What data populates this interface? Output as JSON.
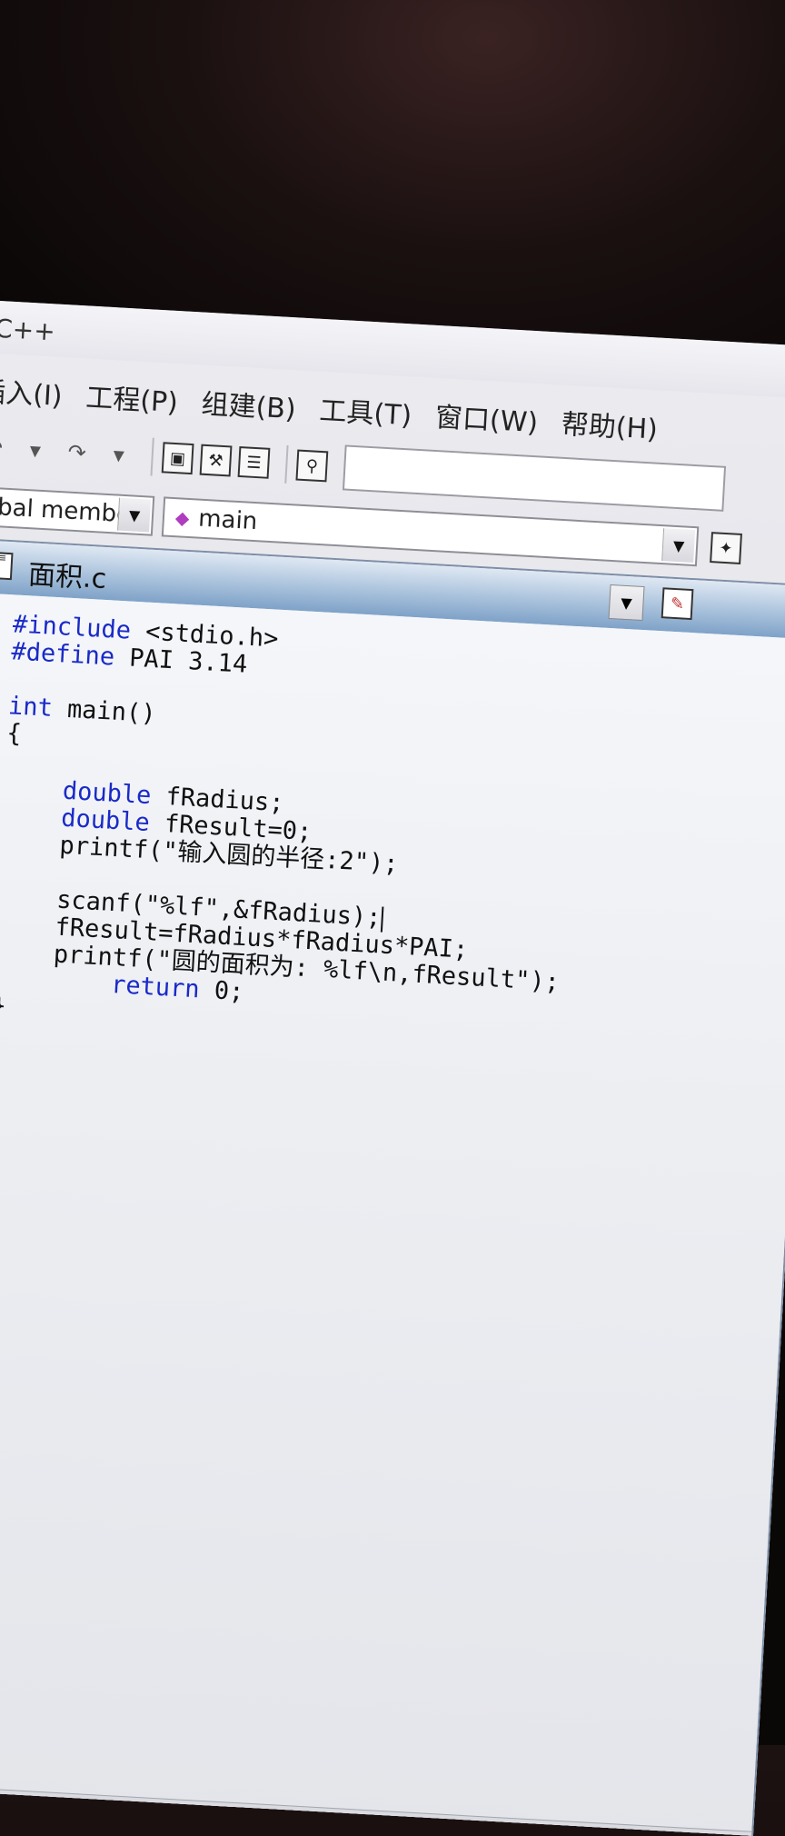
{
  "app_title": "C++",
  "menu": [
    "插入(I)",
    "工程(P)",
    "组建(B)",
    "工具(T)",
    "窗口(W)",
    "帮助(H)"
  ],
  "toolbar": {
    "undo": "↶",
    "redo": "↷"
  },
  "classbar": {
    "member_filter": "obal member",
    "function": "main"
  },
  "document": {
    "title": "面积.c"
  },
  "code": [
    {
      "kw": "#include",
      "rest": " <stdio.h>"
    },
    {
      "kw": "#define",
      "rest": " PAI 3.14"
    },
    {
      "kw": "",
      "rest": ""
    },
    {
      "kw": "int",
      "rest": " main()"
    },
    {
      "kw": "",
      "rest": "{"
    },
    {
      "kw": "",
      "rest": ""
    },
    {
      "kw": "    double",
      "rest": " fRadius;"
    },
    {
      "kw": "    double",
      "rest": " fResult=0;"
    },
    {
      "kw": "",
      "rest": "    printf(\"输入圆的半径:2\");"
    },
    {
      "kw": "",
      "rest": ""
    },
    {
      "kw": "",
      "rest": "    scanf(\"%lf\",&fRadius);"
    },
    {
      "kw": "",
      "rest": "    fResult=fRadius*fRadius*PAI;"
    },
    {
      "kw": "",
      "rest": "    printf(\"圆的面积为: %lf\\n,fResult\");"
    },
    {
      "kw": "        return",
      "rest": " 0;"
    },
    {
      "kw": "",
      "rest": "}"
    }
  ],
  "icons": {
    "undo": "undo-icon",
    "redo": "redo-icon",
    "workspace": "workspace-icon",
    "output": "output-icon",
    "windows": "window-list-icon",
    "find": "find-in-files-icon",
    "class_wizard": "class-wizard-icon",
    "document": "document-icon"
  }
}
